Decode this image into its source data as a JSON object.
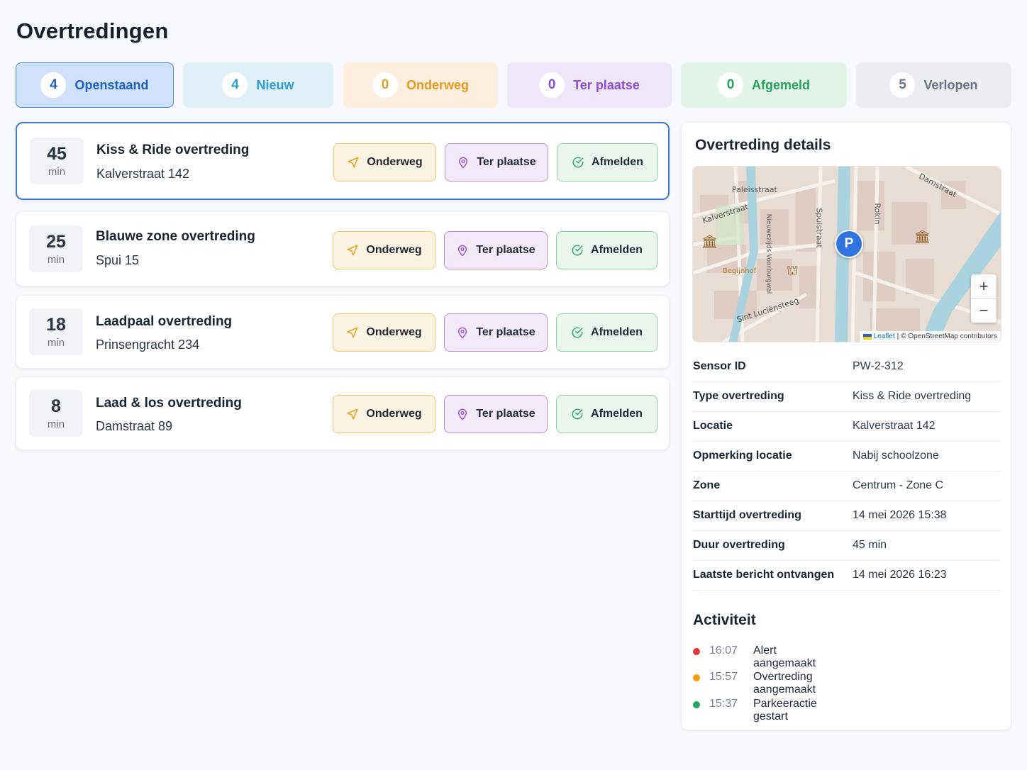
{
  "page": {
    "title": "Overtredingen"
  },
  "tabs": [
    {
      "count": "4",
      "label": "Openstaand",
      "active": true
    },
    {
      "count": "4",
      "label": "Nieuw"
    },
    {
      "count": "0",
      "label": "Onderweg"
    },
    {
      "count": "0",
      "label": "Ter plaatse"
    },
    {
      "count": "0",
      "label": "Afgemeld"
    },
    {
      "count": "5",
      "label": "Verlopen"
    }
  ],
  "buttons": {
    "onderweg": "Onderweg",
    "ter_plaatse": "Ter plaatse",
    "afmelden": "Afmelden"
  },
  "violations": [
    {
      "minutes": "45",
      "unit": "min",
      "title": "Kiss & Ride overtreding",
      "address": "Kalverstraat 142",
      "selected": true
    },
    {
      "minutes": "25",
      "unit": "min",
      "title": "Blauwe zone overtreding",
      "address": "Spui 15"
    },
    {
      "minutes": "18",
      "unit": "min",
      "title": "Laadpaal overtreding",
      "address": "Prinsengracht 234"
    },
    {
      "minutes": "8",
      "unit": "min",
      "title": "Laad & los overtreding",
      "address": "Damstraat 89"
    }
  ],
  "details": {
    "title": "Overtreding details",
    "map": {
      "marker": "P",
      "zoom_in": "+",
      "zoom_out": "−",
      "attribution_leaflet": "Leaflet",
      "attribution_separator": "|",
      "attribution_osm": "© OpenStreetMap contributors",
      "streets": [
        "Paleisstraat",
        "Kalverstraat",
        "Damstraat",
        "Sint Luciënsteeg",
        "Rokin",
        "Spuistraat",
        "Nieuwezijds Voorburgwal",
        "Begijnhof"
      ]
    },
    "rows": [
      {
        "label": "Sensor ID",
        "value": "PW-2-312"
      },
      {
        "label": "Type overtreding",
        "value": "Kiss & Ride overtreding"
      },
      {
        "label": "Locatie",
        "value": "Kalverstraat 142"
      },
      {
        "label": "Opmerking locatie",
        "value": "Nabij schoolzone"
      },
      {
        "label": "Zone",
        "value": "Centrum - Zone C"
      },
      {
        "label": "Starttijd overtreding",
        "value": "14 mei 2026 15:38"
      },
      {
        "label": "Duur overtreding",
        "value": "45 min"
      },
      {
        "label": "Laatste bericht ontvangen",
        "value": "14 mei 2026 16:23"
      }
    ]
  },
  "activity": {
    "title": "Activiteit",
    "items": [
      {
        "time": "16:07",
        "text": "Alert aangemaakt",
        "color": "#e5383b"
      },
      {
        "time": "15:57",
        "text": "Overtreding aangemaakt",
        "color": "#f59e0b"
      },
      {
        "time": "15:37",
        "text": "Parkeeractie gestart",
        "color": "#22a55b"
      }
    ]
  },
  "colors": {
    "accent": "#3d7bd6",
    "onderweg": "#f2c46b",
    "ter_plaatse": "#b98de0",
    "afgemeld": "#8fd4a8"
  }
}
